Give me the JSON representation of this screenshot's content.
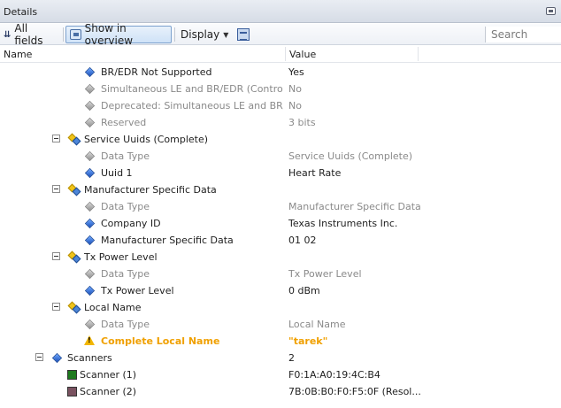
{
  "panel": {
    "title": "Details"
  },
  "toolbar": {
    "all_fields": "All fields",
    "show_in_overview": "Show in overview",
    "display": "Display",
    "search_placeholder": "Search"
  },
  "columns": {
    "name": "Name",
    "value": "Value"
  },
  "rows": [
    {
      "name": "BR/EDR Not Supported",
      "value": "Yes"
    },
    {
      "name": "Simultaneous LE and BR/EDR (Controller)",
      "value": "No"
    },
    {
      "name": "Deprecated: Simultaneous LE and BR/E...",
      "value": "No"
    },
    {
      "name": "Reserved",
      "value": "3 bits"
    },
    {
      "name": "Service Uuids (Complete)",
      "value": ""
    },
    {
      "name": "Data Type",
      "value": "Service Uuids (Complete)"
    },
    {
      "name": "Uuid 1",
      "value": "Heart Rate"
    },
    {
      "name": "Manufacturer Specific Data",
      "value": ""
    },
    {
      "name": "Data Type",
      "value": "Manufacturer Specific Data"
    },
    {
      "name": "Company ID",
      "value": "Texas Instruments Inc."
    },
    {
      "name": "Manufacturer Specific Data",
      "value": "01 02"
    },
    {
      "name": "Tx Power Level",
      "value": ""
    },
    {
      "name": "Data Type",
      "value": "Tx Power Level"
    },
    {
      "name": "Tx Power Level",
      "value": "0 dBm"
    },
    {
      "name": "Local Name",
      "value": ""
    },
    {
      "name": "Data Type",
      "value": "Local Name"
    },
    {
      "name": "Complete Local Name",
      "value": "\"tarek\""
    },
    {
      "name": "Scanners",
      "value": "2"
    },
    {
      "name": "Scanner (1)",
      "value": "F0:1A:A0:19:4C:B4"
    },
    {
      "name": "Scanner (2)",
      "value": "7B:0B:B0:F0:F5:0F (Resol..."
    }
  ],
  "colors": {
    "warning_text": "#f0a000",
    "scanner1": "#1e7a1e",
    "scanner2": "#7a5260"
  }
}
